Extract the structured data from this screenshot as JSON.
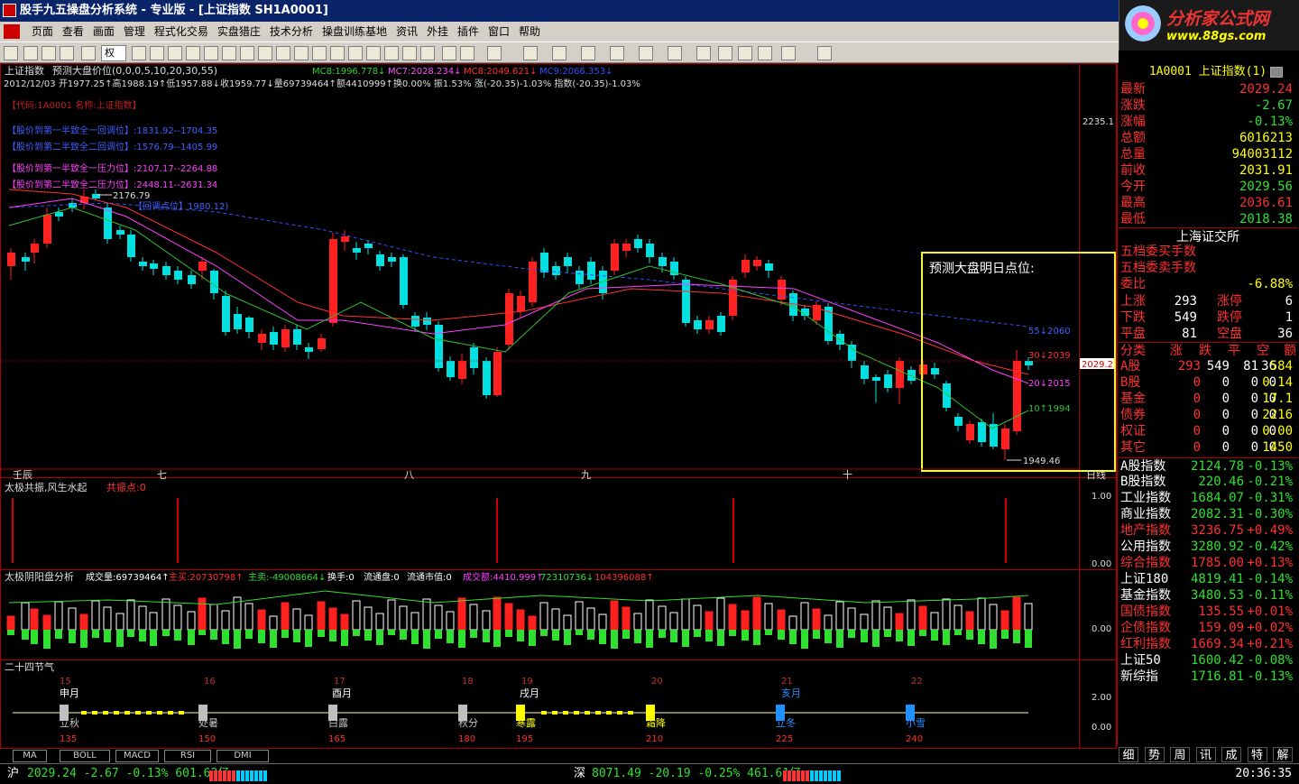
{
  "window": {
    "title": "股手九五操盘分析系统 - 专业版 - [上证指数 SH1A0001]"
  },
  "logo": {
    "name": "分析家公式网",
    "url": "www.88gs.com"
  },
  "menu": [
    "页面",
    "查看",
    "画面",
    "管理",
    "程式化交易",
    "实盘猎庄",
    "技术分析",
    "操盘训练基地",
    "资讯",
    "外挂",
    "插件",
    "窗口",
    "帮助"
  ],
  "toolbar": {
    "weight_select": "权"
  },
  "main_chart": {
    "header_title": "上证指数",
    "header_indicator": "预测大盘价位(0,0,0,5,10,20,30,55)",
    "header_ma": [
      {
        "text": "MC8:1996.778↓",
        "color": "#30d030"
      },
      {
        "text": "MC7:2028.234↓",
        "color": "#ff50ff"
      },
      {
        "text": "MC8:2049.621↓",
        "color": "#ff3030"
      },
      {
        "text": "MC9:2066.353↓",
        "color": "#3050ff"
      }
    ],
    "info_line": "2012/12/03 开1977.25↑高1988.19↑低1957.88↓收1959.77↓量69739464↑额4410999↑换0.00% 振1.53% 涨(-20.35)-1.03% 指数(-20.35)-1.03%",
    "annotations": [
      {
        "text": "【代码:1A0001 名称:上证指数】",
        "color": "#c02020"
      },
      {
        "text": "【股价到第一半致全一回调位】:1831.92--1704.35",
        "color": "#4060ff"
      },
      {
        "text": "【股价到第二半致全二回调位】:1576.79--1405.99",
        "color": "#4060ff"
      },
      {
        "text": "【股价到第一半致全一压力位】:2107.17--2264.88",
        "color": "#ff40ff"
      },
      {
        "text": "【股价到第二半致全二压力位】:2448.11--2631.34",
        "color": "#ff40ff"
      },
      {
        "text": "【回调点位】1980.12)",
        "color": "#4060ff"
      }
    ],
    "high_label": "2176.79",
    "low_label": "1949.46",
    "price_axis_top": "2235.1",
    "price_axis_current": "2029.2",
    "forecast_box_title": "预测大盘明日点位:",
    "forecast_levels": [
      {
        "text": "55↓2060",
        "color": "#4060ff"
      },
      {
        "text": "30↓2039",
        "color": "#ff3030"
      },
      {
        "text": "20↓2015",
        "color": "#ff40ff"
      },
      {
        "text": "10↑1994",
        "color": "#30c030"
      }
    ],
    "months": [
      "壬辰",
      "七",
      "八",
      "九",
      "十"
    ],
    "corner_label": "日线"
  },
  "sub1": {
    "title": "太极共振,风生水起",
    "sub": "共振点:0",
    "axis": [
      "1.00",
      "0.00"
    ]
  },
  "sub2": {
    "title": "太极阴阳盘分析",
    "segments": [
      {
        "text": "成交量:69739464↑",
        "color": "#ffffff"
      },
      {
        "text": "主买:20730798↑",
        "color": "#ff3030"
      },
      {
        "text": "主卖:-49008664↓",
        "color": "#30e030"
      },
      {
        "text": "换手:0",
        "color": "#ffffff"
      },
      {
        "text": "流通盘:0",
        "color": "#ffffff"
      },
      {
        "text": "流通市值:0",
        "color": "#ffffff"
      },
      {
        "text": "成交额:4410.999↑",
        "color": "#ff40ff"
      },
      {
        "text": "72310736↓",
        "color": "#30e030"
      },
      {
        "text": "104396088↑",
        "color": "#ff3030"
      }
    ],
    "axis": "0.00"
  },
  "sub3": {
    "title": "二十四节气",
    "axis": [
      "2.00",
      "0.00"
    ],
    "top_nums": [
      "15",
      "16",
      "17",
      "18",
      "19",
      "20",
      "21",
      "22"
    ],
    "months": [
      "申月",
      "酉月",
      "戌月",
      "亥月"
    ],
    "terms": [
      {
        "name": "立秋",
        "deg": "135",
        "color": "#c0c0c0"
      },
      {
        "name": "处暑",
        "deg": "150",
        "color": "#c0c0c0"
      },
      {
        "name": "白露",
        "deg": "165",
        "color": "#c0c0c0"
      },
      {
        "name": "秋分",
        "deg": "180",
        "color": "#c0c0c0"
      },
      {
        "name": "寒露",
        "deg": "195",
        "color": "#ffff00"
      },
      {
        "name": "霜降",
        "deg": "210",
        "color": "#ffff00"
      },
      {
        "name": "立冬",
        "deg": "225",
        "color": "#1e90ff"
      },
      {
        "name": "小雪",
        "deg": "240",
        "color": "#1e90ff"
      }
    ]
  },
  "bottom_tabs": [
    "MA",
    "BOLL",
    "MACD",
    "RSI",
    "DMI"
  ],
  "right_panel": {
    "title": "1A0001 上证指数(1)",
    "quote": [
      {
        "label": "最新",
        "value": "2029.24",
        "color": "#ff3030"
      },
      {
        "label": "涨跌",
        "value": "-2.67",
        "color": "#30e030"
      },
      {
        "label": "涨幅",
        "value": "-0.13%",
        "color": "#30e030"
      },
      {
        "label": "总额",
        "value": "6016213",
        "color": "#ffff00"
      },
      {
        "label": "总量",
        "value": "94003112",
        "color": "#ffff00"
      },
      {
        "label": "前收",
        "value": "2031.91",
        "color": "#ffff00"
      },
      {
        "label": "今开",
        "value": "2029.56",
        "color": "#30e030"
      },
      {
        "label": "最高",
        "value": "2036.61",
        "color": "#ff3030"
      },
      {
        "label": "最低",
        "value": "2018.38",
        "color": "#30e030"
      }
    ],
    "exchange": "上海证交所",
    "buy5": "五档委买手数",
    "sell5": "五档委卖手数",
    "weibi": {
      "label": "委比",
      "value": "-6.88%"
    },
    "updown": [
      {
        "l1": "上涨",
        "v1": "293",
        "l2": "涨停",
        "v2": "6"
      },
      {
        "l1": "下跌",
        "v1": "549",
        "l2": "跌停",
        "v2": "1"
      },
      {
        "l1": "平盘",
        "v1": "81",
        "l2": "空盘",
        "v2": "36"
      }
    ],
    "cat_header": [
      "分类",
      "涨",
      "跌",
      "平",
      "空",
      "额"
    ],
    "cats": [
      {
        "n": "A股",
        "a": "293",
        "b": "549",
        "c": "81",
        "d": "36",
        "e": "584"
      },
      {
        "n": "B股",
        "a": "0",
        "b": "0",
        "c": "0",
        "d": "0",
        "e": "0.14"
      },
      {
        "n": "基金",
        "a": "0",
        "b": "0",
        "c": "0",
        "d": "0",
        "e": "17.1"
      },
      {
        "n": "债券",
        "a": "0",
        "b": "0",
        "c": "0",
        "d": "0",
        "e": "2216"
      },
      {
        "n": "权证",
        "a": "0",
        "b": "0",
        "c": "0",
        "d": "0",
        "e": "0.00"
      },
      {
        "n": "其它",
        "a": "0",
        "b": "0",
        "c": "0",
        "d": "0",
        "e": "1450"
      }
    ],
    "indices": [
      {
        "n": "A股指数",
        "v": "2124.78",
        "p": "-0.13%",
        "c": "#30e030"
      },
      {
        "n": "B股指数",
        "v": "220.46",
        "p": "-0.21%",
        "c": "#30e030"
      },
      {
        "n": "工业指数",
        "v": "1684.07",
        "p": "-0.31%",
        "c": "#30e030"
      },
      {
        "n": "商业指数",
        "v": "2082.31",
        "p": "-0.30%",
        "c": "#30e030"
      },
      {
        "n": "地产指数",
        "v": "3236.75",
        "p": "+0.49%",
        "c": "#ff3030"
      },
      {
        "n": "公用指数",
        "v": "3280.92",
        "p": "-0.42%",
        "c": "#30e030"
      },
      {
        "n": "综合指数",
        "v": "1785.00",
        "p": "+0.13%",
        "c": "#ff3030"
      },
      {
        "n": "上证180",
        "v": "4819.41",
        "p": "-0.14%",
        "c": "#30e030"
      },
      {
        "n": "基金指数",
        "v": "3480.53",
        "p": "-0.11%",
        "c": "#30e030"
      },
      {
        "n": "国债指数",
        "v": "135.55",
        "p": "+0.01%",
        "c": "#ff3030"
      },
      {
        "n": "企债指数",
        "v": "159.09",
        "p": "+0.02%",
        "c": "#ff3030"
      },
      {
        "n": "红利指数",
        "v": "1669.34",
        "p": "+0.21%",
        "c": "#ff3030"
      },
      {
        "n": "上证50",
        "v": "1600.42",
        "p": "-0.08%",
        "c": "#30e030"
      },
      {
        "n": "新综指",
        "v": "1716.81",
        "p": "-0.13%",
        "c": "#30e030"
      }
    ],
    "tabs": [
      "细",
      "势",
      "周",
      "讯",
      "成",
      "特",
      "解"
    ]
  },
  "statusbar": {
    "sh_label": "沪",
    "sh_text": "2029.24 -2.67 -0.13% 601.62亿",
    "sz_label": "深",
    "sz_text": "8071.49 -20.19 -0.25% 461.61亿",
    "time": "20:36:35"
  }
}
